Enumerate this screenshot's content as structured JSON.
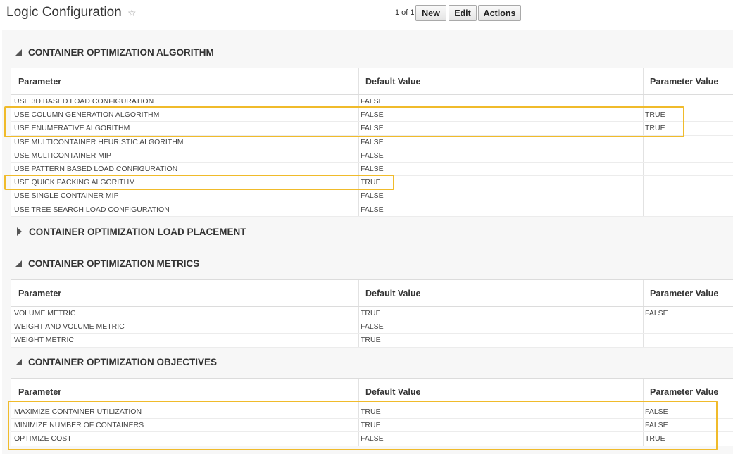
{
  "header": {
    "title": "Logic Configuration",
    "pager": "1 of 1",
    "buttons": {
      "new": "New",
      "edit": "Edit",
      "actions": "Actions"
    }
  },
  "columns": {
    "parameter": "Parameter",
    "default_value": "Default Value",
    "parameter_value": "Parameter Value"
  },
  "sections": {
    "algorithm": {
      "title": "CONTAINER OPTIMIZATION ALGORITHM",
      "expanded": true,
      "rows": [
        {
          "parameter": "USE 3D BASED LOAD CONFIGURATION",
          "default": "FALSE",
          "value": ""
        },
        {
          "parameter": "USE COLUMN GENERATION ALGORITHM",
          "default": "FALSE",
          "value": "TRUE"
        },
        {
          "parameter": "USE ENUMERATIVE ALGORITHM",
          "default": "FALSE",
          "value": "TRUE"
        },
        {
          "parameter": "USE MULTICONTAINER HEURISTIC ALGORITHM",
          "default": "FALSE",
          "value": ""
        },
        {
          "parameter": "USE MULTICONTAINER MIP",
          "default": "FALSE",
          "value": ""
        },
        {
          "parameter": "USE PATTERN BASED LOAD CONFIGURATION",
          "default": "FALSE",
          "value": ""
        },
        {
          "parameter": "USE QUICK PACKING ALGORITHM",
          "default": "TRUE",
          "value": ""
        },
        {
          "parameter": "USE SINGLE CONTAINER MIP",
          "default": "FALSE",
          "value": ""
        },
        {
          "parameter": "USE TREE SEARCH LOAD CONFIGURATION",
          "default": "FALSE",
          "value": ""
        }
      ]
    },
    "load_placement": {
      "title": "CONTAINER OPTIMIZATION LOAD PLACEMENT",
      "expanded": false
    },
    "metrics": {
      "title": "CONTAINER OPTIMIZATION METRICS",
      "expanded": true,
      "rows": [
        {
          "parameter": "VOLUME METRIC",
          "default": "TRUE",
          "value": "FALSE"
        },
        {
          "parameter": "WEIGHT AND VOLUME METRIC",
          "default": "FALSE",
          "value": ""
        },
        {
          "parameter": "WEIGHT METRIC",
          "default": "TRUE",
          "value": ""
        }
      ]
    },
    "objectives": {
      "title": "CONTAINER OPTIMIZATION OBJECTIVES",
      "expanded": true,
      "rows": [
        {
          "parameter": "MAXIMIZE CONTAINER UTILIZATION",
          "default": "TRUE",
          "value": "FALSE"
        },
        {
          "parameter": "MINIMIZE NUMBER OF CONTAINERS",
          "default": "TRUE",
          "value": "FALSE"
        },
        {
          "parameter": "OPTIMIZE COST",
          "default": "FALSE",
          "value": "TRUE"
        }
      ]
    }
  },
  "colors": {
    "highlight": "#f0bb2b",
    "background": "#f7f7f7",
    "table_bg": "#ffffff"
  },
  "icons": {
    "favorite": "star-outline-icon",
    "expanded": "triangle-expanded-icon",
    "collapsed": "triangle-collapsed-icon"
  }
}
